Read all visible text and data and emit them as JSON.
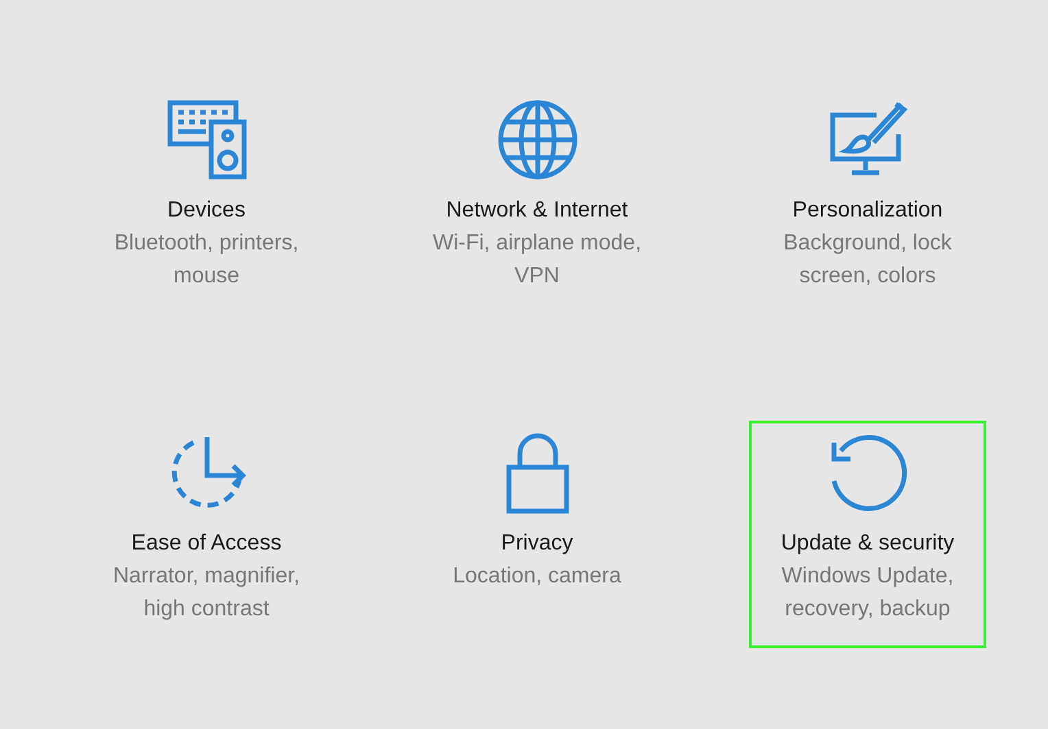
{
  "categories": [
    {
      "kind": "devices",
      "title": "Devices",
      "description": "Bluetooth, printers, mouse",
      "selected": false
    },
    {
      "kind": "network",
      "title": "Network & Internet",
      "description": "Wi-Fi, airplane mode, VPN",
      "selected": false
    },
    {
      "kind": "personalization",
      "title": "Personalization",
      "description": "Background, lock screen, colors",
      "selected": false
    },
    {
      "kind": "ease",
      "title": "Ease of Access",
      "description": "Narrator, magnifier, high contrast",
      "selected": false
    },
    {
      "kind": "privacy",
      "title": "Privacy",
      "description": "Location, camera",
      "selected": false
    },
    {
      "kind": "update",
      "title": "Update & security",
      "description": "Windows Update, recovery, backup",
      "selected": true
    }
  ]
}
